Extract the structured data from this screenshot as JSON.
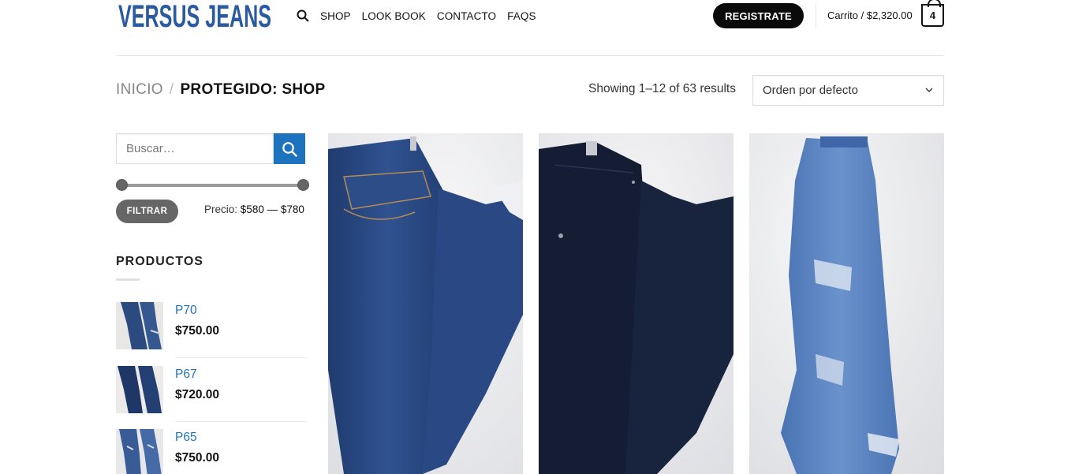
{
  "header": {
    "logo_text": "VERSUS JEANS",
    "nav": [
      "SHOP",
      "LOOK BOOK",
      "CONTACTO",
      "FAQS"
    ],
    "register_label": "REGISTRATE",
    "cart_label": "Carrito / $2,320.00",
    "cart_count": "4",
    "icons": [
      "search-icon",
      "cart-icon"
    ]
  },
  "breadcrumb": {
    "home": "INICIO",
    "separator": "/",
    "current": "PROTEGIDO: SHOP"
  },
  "results_text": "Showing 1–12 of 63 results",
  "sort": {
    "selected": "Orden por defecto"
  },
  "sidebar": {
    "search_placeholder": "Buscar…",
    "filter_label": "FILTRAR",
    "price_prefix": "Precio:",
    "price_range": "$580 — $780",
    "products_heading": "PRODUCTOS",
    "products": [
      {
        "name": "P70",
        "price": "$750.00"
      },
      {
        "name": "P67",
        "price": "$720.00"
      },
      {
        "name": "P65",
        "price": "$750.00"
      }
    ]
  },
  "colors": {
    "accent_blue": "#1e73be",
    "logo_blue": "#2a5aa0",
    "button_dark": "#0a0a0a",
    "filter_gray": "#666666"
  }
}
